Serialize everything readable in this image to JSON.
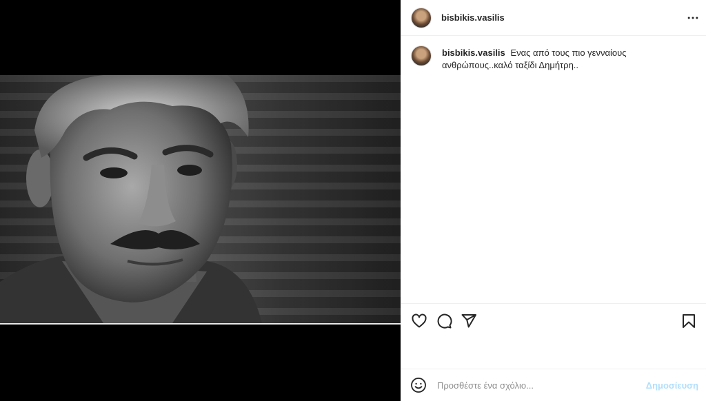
{
  "post": {
    "username": "bisbikis.vasilis",
    "caption": "Ενας από τους πιο γενναίους ανθρώπους..καλό ταξίδι Δημήτρη..",
    "image_alt": "black-and-white portrait of man with curly grey hair and mustache"
  },
  "header": {
    "more_icon": "more-horizontal-icon"
  },
  "actions": {
    "icons": [
      "heart-icon",
      "comment-icon",
      "share-icon",
      "bookmark-icon"
    ]
  },
  "comment": {
    "placeholder": "Προσθέστε ένα σχόλιο...",
    "post_label": "Δημοσίευση",
    "emoji_icon": "emoji-icon"
  },
  "colors": {
    "text": "#262626",
    "muted": "#8e8e8e",
    "border": "#efefef",
    "post_disabled": "#b2dffc"
  }
}
